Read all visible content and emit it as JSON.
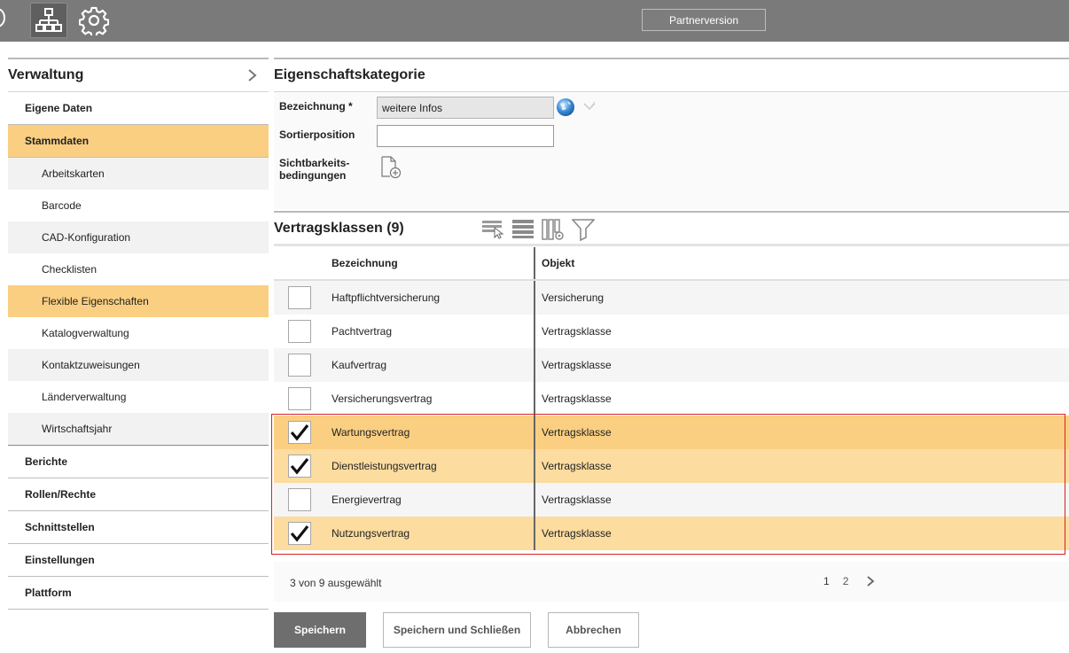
{
  "topbar": {
    "partner_label": "Partnerversion",
    "icons": [
      "org-chart-icon",
      "gear-icon"
    ]
  },
  "sidebar": {
    "title": "Verwaltung",
    "items_top": [
      {
        "label": "Eigene Daten"
      },
      {
        "label": "Stammdaten",
        "active": true
      }
    ],
    "subitems": [
      {
        "label": "Arbeitskarten"
      },
      {
        "label": "Barcode"
      },
      {
        "label": "CAD-Konfiguration"
      },
      {
        "label": "Checklisten"
      },
      {
        "label": "Flexible Eigenschaften",
        "active": true
      },
      {
        "label": "Katalogverwaltung"
      },
      {
        "label": "Kontaktzuweisungen"
      },
      {
        "label": "Länderverwaltung"
      },
      {
        "label": "Wirtschaftsjahr"
      }
    ],
    "items_bottom": [
      {
        "label": "Berichte"
      },
      {
        "label": "Rollen/Rechte"
      },
      {
        "label": "Schnittstellen"
      },
      {
        "label": "Einstellungen"
      },
      {
        "label": "Plattform"
      }
    ]
  },
  "form": {
    "section_title": "Eigenschaftskategorie",
    "bezeichnung_label": "Bezeichnung *",
    "bezeichnung_value": "weitere Infos",
    "sortier_label": "Sortierposition",
    "sortier_value": "",
    "sicht_label_1": "Sichtbarkeits-",
    "sicht_label_2": "bedingungen"
  },
  "grid": {
    "title": "Vertragsklassen (9)",
    "col_name": "Bezeichnung",
    "col_obj": "Objekt",
    "rows": [
      {
        "name": "Haftpflichtversicherung",
        "obj": "Versicherung",
        "checked": false
      },
      {
        "name": "Pachtvertrag",
        "obj": "Vertragsklasse",
        "checked": false
      },
      {
        "name": "Kaufvertrag",
        "obj": "Vertragsklasse",
        "checked": false
      },
      {
        "name": "Versicherungsvertrag",
        "obj": "Vertragsklasse",
        "checked": false
      },
      {
        "name": "Wartungsvertrag",
        "obj": "Vertragsklasse",
        "checked": true
      },
      {
        "name": "Dienstleistungsvertrag",
        "obj": "Vertragsklasse",
        "checked": true
      },
      {
        "name": "Energievertrag",
        "obj": "Vertragsklasse",
        "checked": false
      },
      {
        "name": "Nutzungsvertrag",
        "obj": "Vertragsklasse",
        "checked": true
      }
    ],
    "selected_count": "3",
    "selected_suffix": "von 9 ausgewählt",
    "pages": [
      "1",
      "2"
    ]
  },
  "buttons": {
    "save": "Speichern",
    "save_close": "Speichern und Schließen",
    "cancel": "Abbrechen"
  },
  "colors": {
    "topbar": "#7a7a7a",
    "highlight": "#fbcf82",
    "highlight_light": "#fcdc9f",
    "selection_frame": "#d62020",
    "primary_button": "#6e6e6e"
  }
}
